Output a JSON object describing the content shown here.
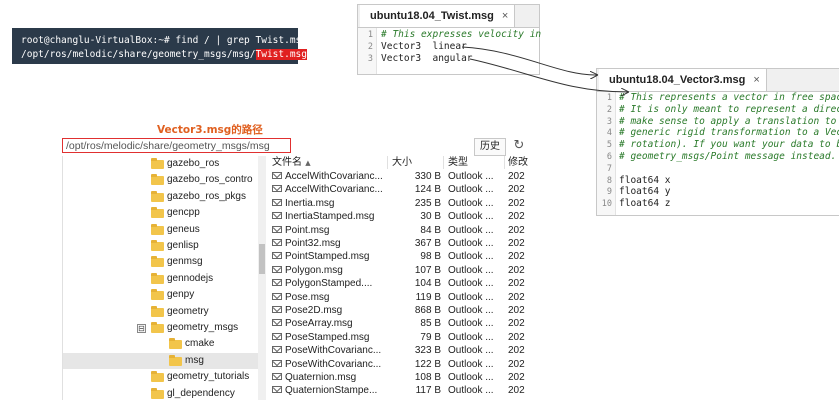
{
  "terminal": {
    "line1": "root@changlu-VirtualBox:~# find / | grep Twist.msg",
    "line2_prefix": "/opt/ros/melodic/share/geometry_msgs/msg/",
    "line2_highlight": "Twist.msg"
  },
  "twist_editor": {
    "tab_title": "ubuntu18.04_Twist.msg",
    "close_glyph": "×",
    "lines": [
      {
        "num": "1",
        "text": "# This expresses velocity in",
        "kind": "comment"
      },
      {
        "num": "2",
        "text": "Vector3  linear",
        "kind": "plain"
      },
      {
        "num": "3",
        "text": "Vector3  angular",
        "kind": "plain"
      }
    ]
  },
  "vector3_editor": {
    "tab_title": "ubuntu18.04_Vector3.msg",
    "close_glyph": "×",
    "lines": [
      {
        "num": "1",
        "text": "# This represents a vector in free space",
        "kind": "comment"
      },
      {
        "num": "2",
        "text": "# It is only meant to represent a direct",
        "kind": "comment"
      },
      {
        "num": "3",
        "text": "# make sense to apply a translation to i",
        "kind": "comment"
      },
      {
        "num": "4",
        "text": "# generic rigid transformation to a Vect",
        "kind": "comment"
      },
      {
        "num": "5",
        "text": "# rotation). If you want your data to be",
        "kind": "comment"
      },
      {
        "num": "6",
        "text": "# geometry_msgs/Point message instead.",
        "kind": "comment"
      },
      {
        "num": "7",
        "text": "",
        "kind": "plain"
      },
      {
        "num": "8",
        "text": "float64 x",
        "kind": "plain"
      },
      {
        "num": "9",
        "text": "float64 y",
        "kind": "plain"
      },
      {
        "num": "10",
        "text": "float64 z",
        "kind": "plain"
      }
    ]
  },
  "explorer": {
    "caption": "Vector3.msg的路径",
    "address": "/opt/ros/melodic/share/geometry_msgs/msg",
    "history_button": "历史",
    "refresh_icon": "refresh-icon",
    "tree": [
      {
        "label": "gazebo_ros",
        "level": 0
      },
      {
        "label": "gazebo_ros_contro",
        "level": 0
      },
      {
        "label": "gazebo_ros_pkgs",
        "level": 0
      },
      {
        "label": "gencpp",
        "level": 0
      },
      {
        "label": "geneus",
        "level": 0
      },
      {
        "label": "genlisp",
        "level": 0
      },
      {
        "label": "genmsg",
        "level": 0
      },
      {
        "label": "gennodejs",
        "level": 0
      },
      {
        "label": "genpy",
        "level": 0
      },
      {
        "label": "geometry",
        "level": 0
      },
      {
        "label": "geometry_msgs",
        "level": 0,
        "expanded": true,
        "expander": "⊟"
      },
      {
        "label": "cmake",
        "level": 1
      },
      {
        "label": "msg",
        "level": 1,
        "selected": true
      },
      {
        "label": "geometry_tutorials",
        "level": 0
      },
      {
        "label": "gl_dependency",
        "level": 0
      }
    ],
    "columns": {
      "name": "文件名",
      "sort_glyph": "▲",
      "size": "大小",
      "type": "类型",
      "date": "修改"
    },
    "files": [
      {
        "name": "AccelWithCovarianc...",
        "size": "330 B",
        "type": "Outlook ...",
        "date": "202"
      },
      {
        "name": "AccelWithCovarianc...",
        "size": "124 B",
        "type": "Outlook ...",
        "date": "202"
      },
      {
        "name": "Inertia.msg",
        "size": "235 B",
        "type": "Outlook ...",
        "date": "202"
      },
      {
        "name": "InertiaStamped.msg",
        "size": "30 B",
        "type": "Outlook ...",
        "date": "202"
      },
      {
        "name": "Point.msg",
        "size": "84 B",
        "type": "Outlook ...",
        "date": "202"
      },
      {
        "name": "Point32.msg",
        "size": "367 B",
        "type": "Outlook ...",
        "date": "202"
      },
      {
        "name": "PointStamped.msg",
        "size": "98 B",
        "type": "Outlook ...",
        "date": "202"
      },
      {
        "name": "Polygon.msg",
        "size": "107 B",
        "type": "Outlook ...",
        "date": "202"
      },
      {
        "name": "PolygonStamped....",
        "size": "104 B",
        "type": "Outlook ...",
        "date": "202"
      },
      {
        "name": "Pose.msg",
        "size": "119 B",
        "type": "Outlook ...",
        "date": "202"
      },
      {
        "name": "Pose2D.msg",
        "size": "868 B",
        "type": "Outlook ...",
        "date": "202"
      },
      {
        "name": "PoseArray.msg",
        "size": "85 B",
        "type": "Outlook ...",
        "date": "202"
      },
      {
        "name": "PoseStamped.msg",
        "size": "79 B",
        "type": "Outlook ...",
        "date": "202"
      },
      {
        "name": "PoseWithCovarianc...",
        "size": "323 B",
        "type": "Outlook ...",
        "date": "202"
      },
      {
        "name": "PoseWithCovarianc...",
        "size": "122 B",
        "type": "Outlook ...",
        "date": "202"
      },
      {
        "name": "Quaternion.msg",
        "size": "108 B",
        "type": "Outlook ...",
        "date": "202"
      },
      {
        "name": "QuaternionStampe...",
        "size": "117 B",
        "type": "Outlook ...",
        "date": "202"
      }
    ]
  },
  "colors": {
    "terminal_bg": "#2b3a4a",
    "highlight": "#e02020",
    "comment": "#2a7a2a",
    "caption": "#e06020",
    "folder": "#f2c54b"
  }
}
